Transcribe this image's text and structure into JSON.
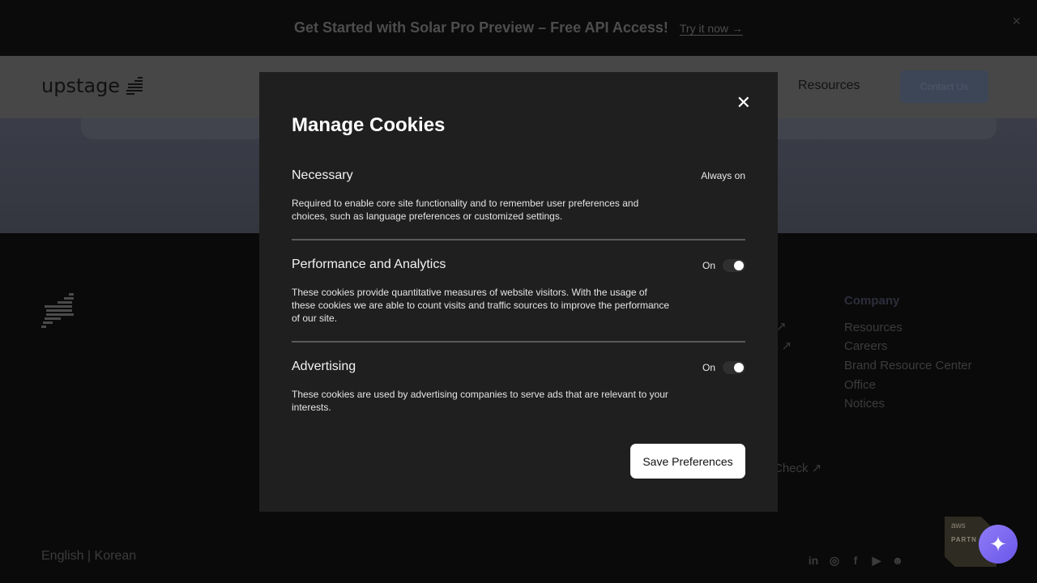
{
  "announcement": {
    "text": "Get Started with Solar Pro Preview – Free API Access!",
    "link_label": "Try it now →",
    "close_icon": "×"
  },
  "header": {
    "logo_text": "upstage",
    "nav_resources": "Resources",
    "contact_label": "Contact Us"
  },
  "footer": {
    "company_title": "Company",
    "company_links": [
      "Resources",
      "Careers",
      "Brand Resource Center",
      "Office",
      "Notices"
    ],
    "partial_links": [
      "↗",
      "e ↗",
      "Check ↗"
    ],
    "language": "English | Korean",
    "socials": [
      "in",
      "◎",
      "f",
      "▶",
      "☻"
    ],
    "aws_word": "aws",
    "aws_partner": "PARTN",
    "assistant_icon": "✦"
  },
  "modal": {
    "title": "Manage Cookies",
    "close_icon": "✕",
    "sections": [
      {
        "title": "Necessary",
        "status": "Always on",
        "description": "Required to enable core site functionality and to remember user preferences and choices, such as language preferences or customized settings."
      },
      {
        "title": "Performance and Analytics",
        "status": "On",
        "enabled": true,
        "description": "These cookies provide quantitative measures of website visitors. With the usage of these cookies we are able to count visits and traffic sources to improve the performance of our site."
      },
      {
        "title": "Advertising",
        "status": "On",
        "enabled": true,
        "description": "These cookies are used by advertising companies to serve ads that are relevant to your interests."
      }
    ],
    "save_label": "Save Preferences"
  }
}
